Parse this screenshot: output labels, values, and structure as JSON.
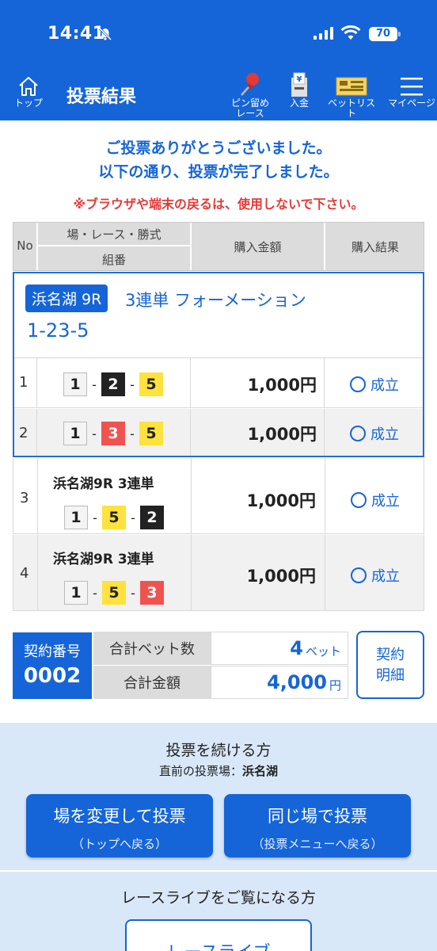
{
  "status": {
    "time": "14:41",
    "battery": "70"
  },
  "header": {
    "title": "投票結果",
    "home_label": "トップ",
    "pin_label_1": "ピン留め",
    "pin_label_2": "レース",
    "deposit_label": "入金",
    "betlist_label": "ベットリスト",
    "mypage_label": "マイページ"
  },
  "messages": {
    "thanks_1": "ご投票ありがとうございました。",
    "thanks_2": "以下の通り、投票が完了しました。",
    "warning": "※ブラウザや端末の戻るは、使用しないで下さい。"
  },
  "table": {
    "col_no": "No",
    "col_race": "場・レース・勝式",
    "col_combo": "組番",
    "col_amount": "購入金額",
    "col_result": "購入結果",
    "formation": {
      "venue": "浜名湖 9R",
      "type": "3連単 フォーメーション",
      "combo": "1-23-5"
    },
    "rows": [
      {
        "no": "1",
        "amount": "1,000円",
        "result": "成立",
        "nums": [
          "1",
          "2",
          "5"
        ]
      },
      {
        "no": "2",
        "amount": "1,000円",
        "result": "成立",
        "nums": [
          "1",
          "3",
          "5"
        ]
      },
      {
        "no": "3",
        "name": "浜名湖9R 3連単",
        "amount": "1,000円",
        "result": "成立",
        "nums": [
          "1",
          "5",
          "2"
        ]
      },
      {
        "no": "4",
        "name": "浜名湖9R 3連単",
        "amount": "1,000円",
        "result": "成立",
        "nums": [
          "1",
          "5",
          "3"
        ]
      }
    ]
  },
  "summary": {
    "contract_label": "契約番号",
    "contract_no": "0002",
    "total_bets_label": "合計ベット数",
    "total_bets_value": "4",
    "total_bets_unit": "ベット",
    "total_amount_label": "合計金額",
    "total_amount_value": "4,000",
    "total_amount_unit": "円",
    "detail_btn_1": "契約",
    "detail_btn_2": "明細"
  },
  "continue": {
    "title": "投票を続ける方",
    "prev_label": "直前の投票場：",
    "prev_venue": "浜名湖",
    "change_main": "場を変更して投票",
    "change_sub": "（トップへ戻る）",
    "same_main": "同じ場で投票",
    "same_sub": "（投票メニューへ戻る）"
  },
  "live": {
    "title": "レースライブをご覧になる方",
    "button": "レースライブ"
  },
  "colors": {
    "primary": "#1565d8",
    "warning": "#e53935",
    "panel": "#d9e8f8"
  }
}
